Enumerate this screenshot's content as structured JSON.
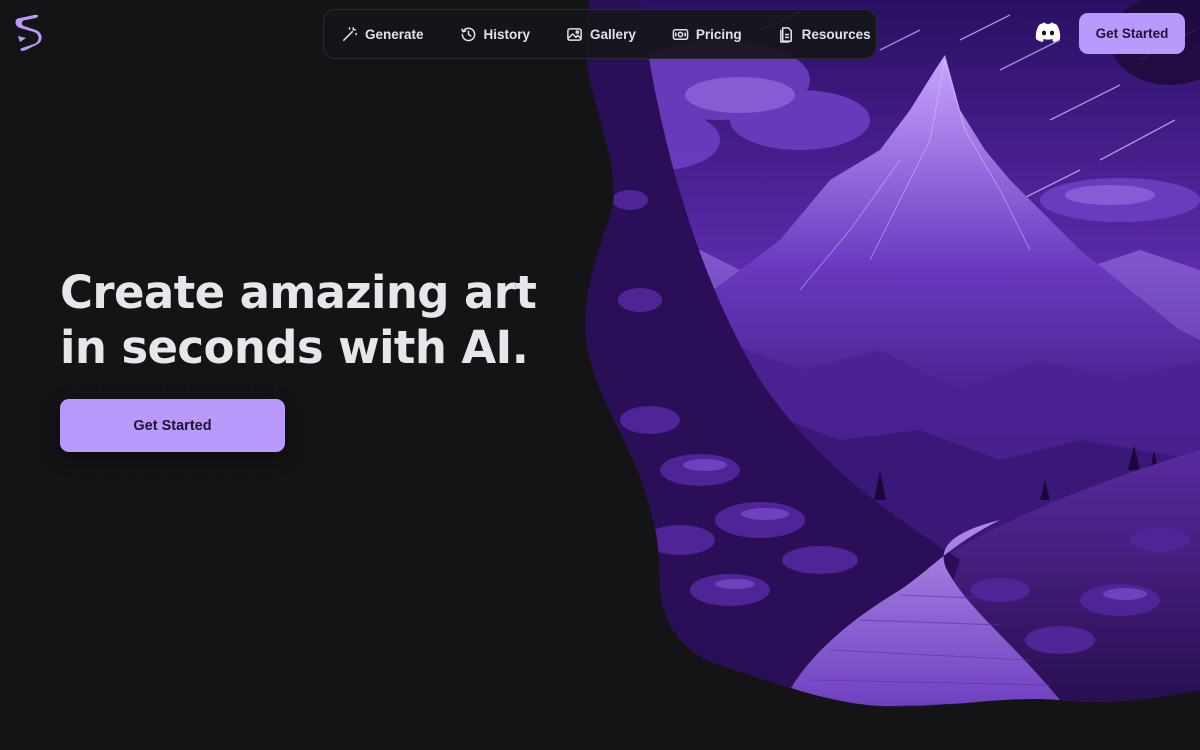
{
  "brand": {
    "logo_icon": "brand-logo-icon",
    "accent_color": "#b999fb"
  },
  "nav": {
    "items": [
      {
        "label": "Generate",
        "icon": "magic-wand-icon"
      },
      {
        "label": "History",
        "icon": "history-clock-icon"
      },
      {
        "label": "Gallery",
        "icon": "image-gallery-icon"
      },
      {
        "label": "Pricing",
        "icon": "pricing-tag-icon"
      },
      {
        "label": "Resources",
        "icon": "document-icon"
      }
    ],
    "discord_icon": "discord-icon",
    "cta_label": "Get Started"
  },
  "hero": {
    "headline_line1": "Create amazing art",
    "headline_line2": "in seconds with AI.",
    "cta_label": "Get Started",
    "artwork": "purple-mountain-path-illustration"
  },
  "colors": {
    "background": "#141416",
    "button_bg": "#b999fb",
    "button_text": "#1d1630",
    "headline": "#e8e6ea"
  }
}
